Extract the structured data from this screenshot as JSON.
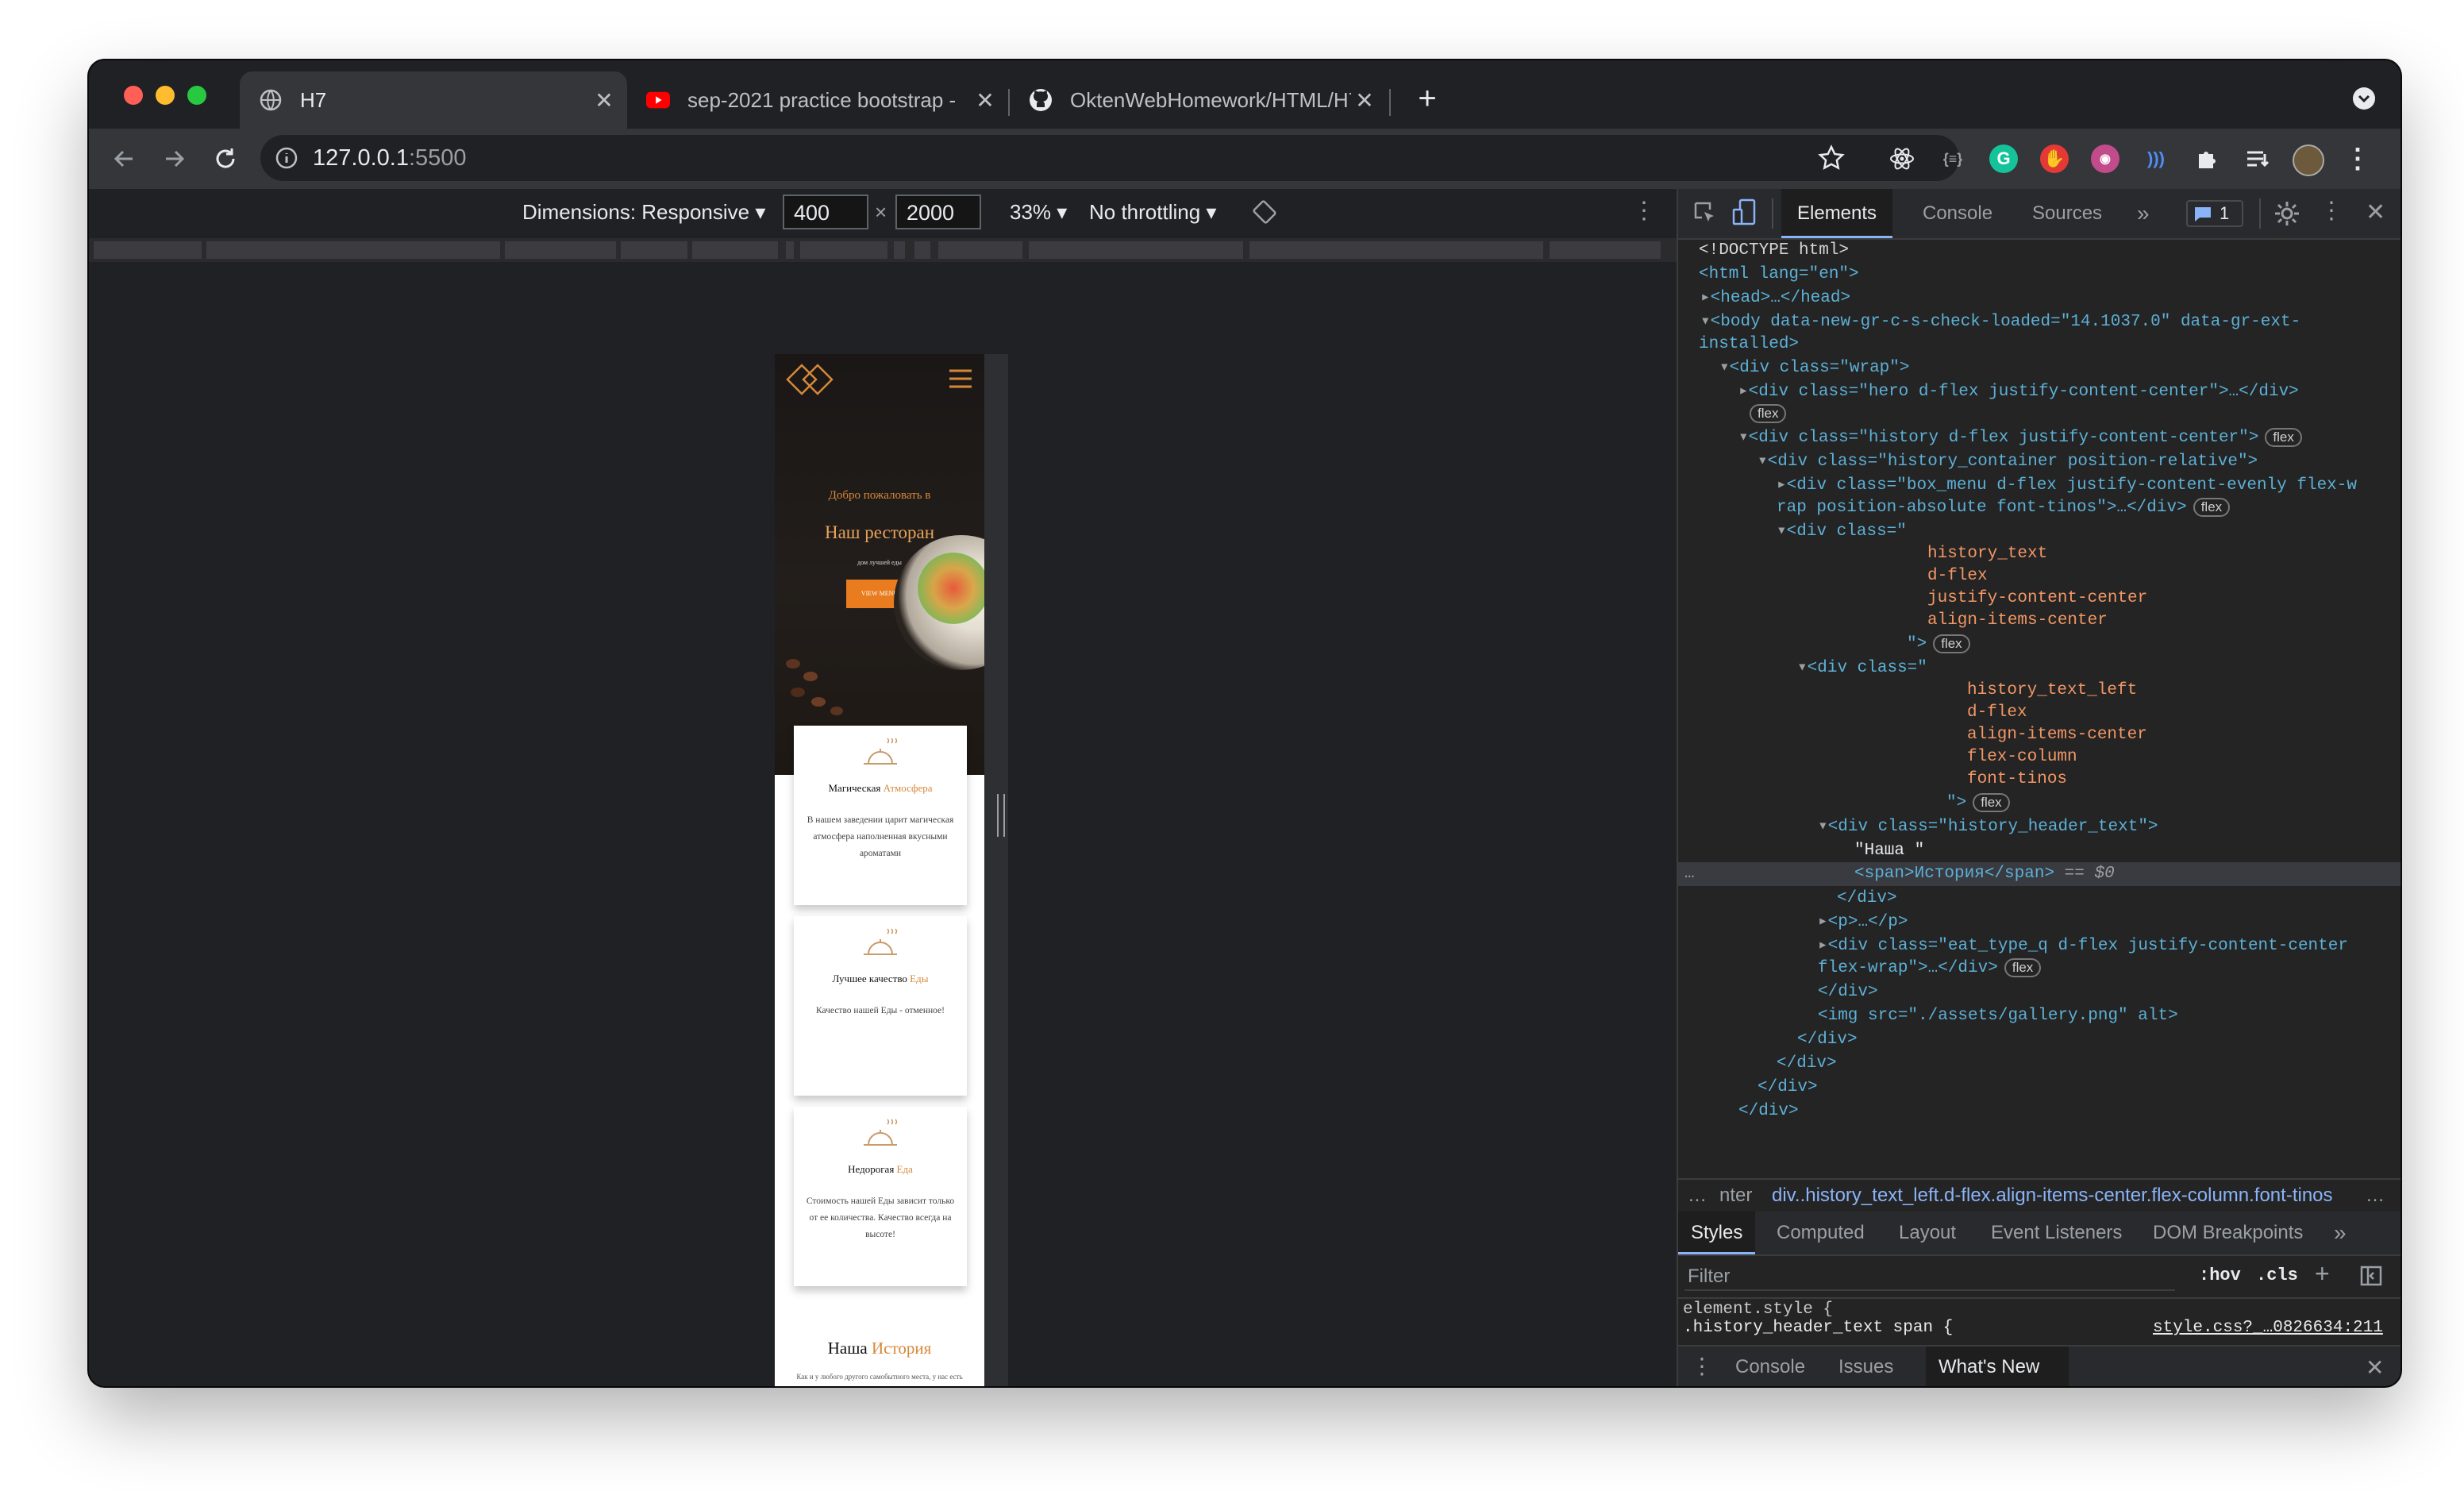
{
  "browser": {
    "tabs": [
      {
        "label": "H7",
        "icon": "globe-icon",
        "active": true
      },
      {
        "label": "sep-2021 practice bootstrap -",
        "icon": "youtube-icon",
        "active": false
      },
      {
        "label": "OktenWebHomework/HTML/H7",
        "icon": "github-icon",
        "active": false
      }
    ],
    "new_tab": "+",
    "address": {
      "host": "127.0.0.1",
      "port": ":5500"
    }
  },
  "device_toolbar": {
    "dimensions_label": "Dimensions: Responsive",
    "width": "400",
    "times": "×",
    "height": "2000",
    "zoom": "33%",
    "throttling": "No throttling"
  },
  "mobile_page": {
    "welcome": "Добро пожаловать в",
    "title": "Наш ресторан",
    "subtitle": "дом лучшей еды",
    "button": "VIEW MENU",
    "cards": [
      {
        "title_main": "Магическая",
        "title_accent": "Атмосфера",
        "text": "В нашем заведении царит магическая атмосфера наполненная вкусными ароматами"
      },
      {
        "title_main": "Лучшее качество",
        "title_accent": "Еды",
        "text": "Качество нашей Еды - отменное!"
      },
      {
        "title_main": "Недорогая",
        "title_accent": "Еда",
        "text": "Стоимость нашей Еды зависит только от ее количества. Качество всегда на высоте!"
      }
    ],
    "history_title": "Наша",
    "history_accent": "История",
    "history_text": "Как и у любого другого самобытного места, у нас есть своя, особая история. Идея ресторана пришла основателям неожиданно. Во время"
  },
  "devtools": {
    "tabs": [
      "Elements",
      "Console",
      "Sources"
    ],
    "more": "»",
    "issues_count": "1",
    "dom": {
      "doctype": "<!DOCTYPE html>",
      "html_open": "<html lang=\"en\">",
      "head": "<head>…</head>",
      "body_l1": "<body data-new-gr-c-s-check-loaded=\"14.1037.0\" data-gr-ext-",
      "body_l2": "installed>",
      "wrap": "<div class=\"wrap\">",
      "hero": "<div class=\"hero d-flex justify-content-center\">…</div>",
      "history": "<div class=\"history d-flex justify-content-center\">",
      "history_container": "<div class=\"history_container position-relative\">",
      "box_menu_l1": "<div class=\"box_menu d-flex justify-content-evenly flex-w",
      "box_menu_l2": "rap position-absolute font-tinos\">…</div>",
      "div_class_open": "<div class=\"",
      "history_text_classes": [
        "history_text",
        "d-flex",
        "justify-content-center",
        "align-items-center"
      ],
      "close_quote": "\">",
      "history_text_left_classes": [
        "history_text_left",
        "d-flex",
        "align-items-center",
        "flex-column",
        "font-tinos"
      ],
      "history_header_text": "<div class=\"history_header_text\">",
      "nasha": "\"Наша \"",
      "span_line": "<span>История</span>",
      "eq": "== $0",
      "div_close": "</div>",
      "p": "<p>…</p>",
      "eat_type_l1": "<div class=\"eat_type_q d-flex justify-content-center",
      "eat_type_l2": "flex-wrap\">…</div>",
      "img": "<img src=\"./assets/gallery.png\" alt>",
      "flex_badge": "flex"
    },
    "breadcrumb": {
      "prefix": "…",
      "left": "nter",
      "current": "div..history_text_left.d-flex.align-items-center.flex-column.font-tinos",
      "suffix": "…"
    },
    "styles_tabs": [
      "Styles",
      "Computed",
      "Layout",
      "Event Listeners",
      "DOM Breakpoints"
    ],
    "filter_placeholder": "Filter",
    "hov": ":hov",
    "cls": ".cls",
    "element_style": "element.style {",
    "close_brace": "}",
    "rule": ".history_header_text span {",
    "rule_source": "style.css?_…0826634:211",
    "drawer_tabs": [
      "Console",
      "Issues",
      "What's New"
    ]
  }
}
